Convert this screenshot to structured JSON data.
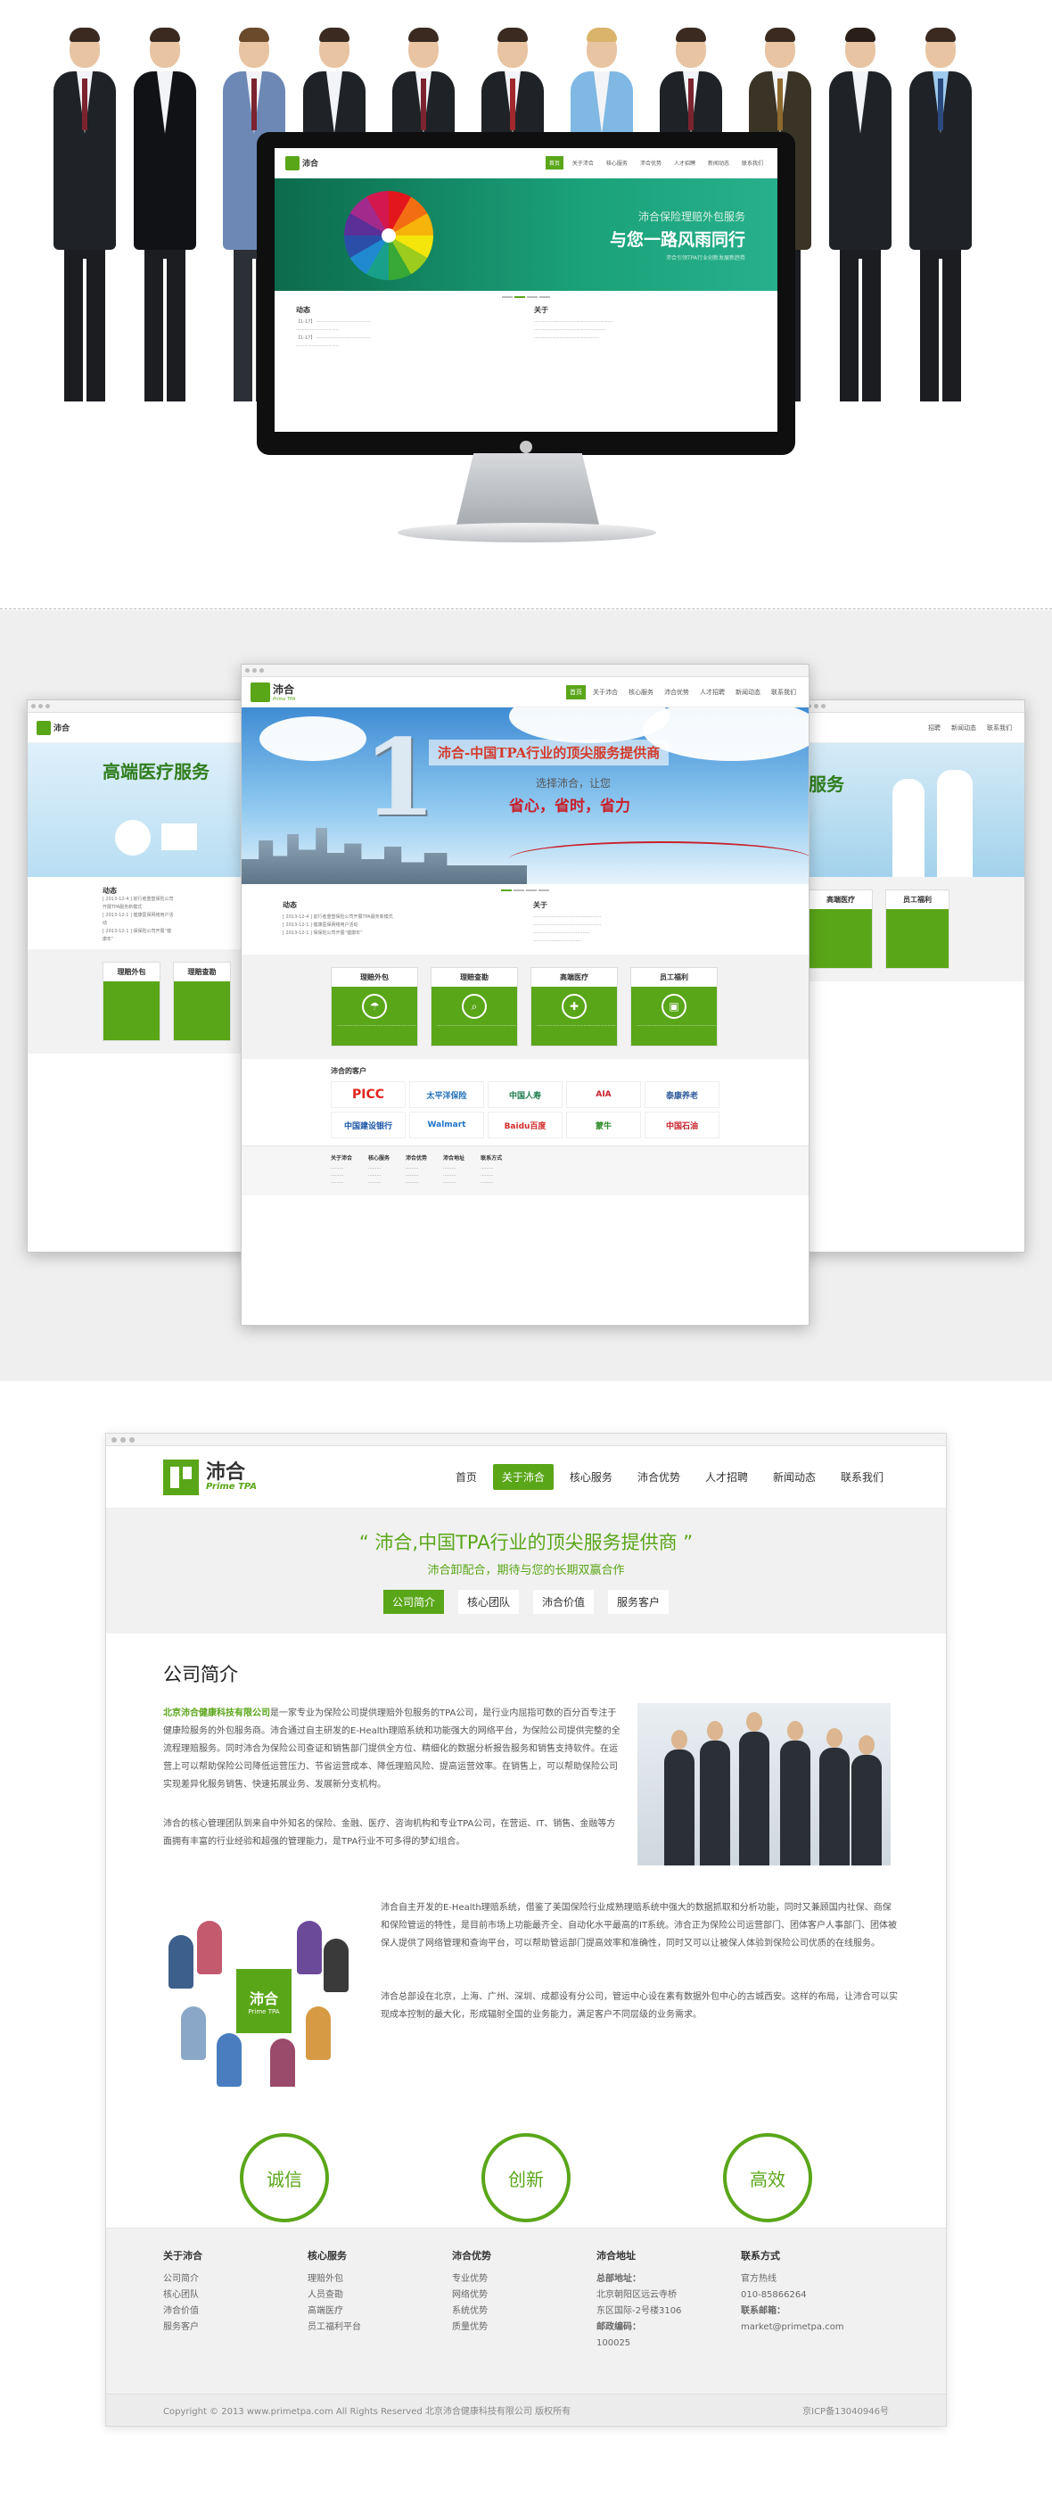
{
  "monitor": {
    "logo_text": "沛合",
    "nav": [
      "首页",
      "关于沛合",
      "核心服务",
      "沛合优势",
      "人才招聘",
      "新闻动态",
      "联系我们"
    ],
    "hero_line1": "沛合保险理赔外包服务",
    "hero_line2": "与您一路风雨同行",
    "hero_line3": "沛合引领TPA行业创新发展新趋势",
    "news_title": "动态",
    "about_title": "关于"
  },
  "showcase": {
    "logo_text": "沛合",
    "logo_en": "Prime TPA",
    "nav": [
      "首页",
      "关于沛合",
      "核心服务",
      "沛合优势",
      "人才招聘",
      "新闻动态",
      "联系我们"
    ],
    "hero_tagline": "沛合-中国TPA行业的顶尖服务提供商",
    "hero_sub1": "选择沛合，让您",
    "hero_sub2": "省心，省时，省力",
    "left_hero": "高端医疗服务",
    "right_hero": "服务",
    "news_title": "动态",
    "news_items": [
      "[ 2013-12-4 ] 前行者重塑保险公司开展TPA服务新模式",
      "[ 2013-12-1 ] 健康医保网络用户活动",
      "[ 2013-12-1 ] 保保险公司开展“健康年”"
    ],
    "about_title": "关于",
    "services": [
      {
        "name": "理赔外包",
        "icon": "umbrella-icon"
      },
      {
        "name": "理赔查勘",
        "icon": "magnifier-icon"
      },
      {
        "name": "高端医疗",
        "icon": "ambulance-icon"
      },
      {
        "name": "员工福利",
        "icon": "gift-icon"
      }
    ],
    "clients_title": "沛合的客户",
    "clients": [
      "PICC",
      "太平洋保险",
      "中国人寿",
      "AIA",
      "泰康养老",
      "中国建设银行",
      "Walmart",
      "Baidu百度",
      "蒙牛",
      "中国石油"
    ]
  },
  "about": {
    "logo_text": "沛合",
    "logo_en": "Prime TPA",
    "nav": [
      "首页",
      "关于沛合",
      "核心服务",
      "沛合优势",
      "人才招聘",
      "新闻动态",
      "联系我们"
    ],
    "nav_active": 1,
    "banner_quote": "“ 沛合,中国TPA行业的顶尖服务提供商 ”",
    "banner_sub": "沛合卸配合，期待与您的长期双赢合作",
    "tabs": [
      "公司简介",
      "核心团队",
      "沛合价值",
      "服务客户"
    ],
    "section_title": "公司简介",
    "company_name": "北京沛合健康科技有限公司",
    "para1": "是一家专业为保险公司提供理赔外包服务的TPA公司，是行业内屈指可数的百分百专注于健康险服务的外包服务商。沛合通过自主研发的E-Health理赔系统和功能强大的网络平台，为保险公司提供完整的全流程理赔服务。同时沛合为保险公司查证和销售部门提供全方位、精细化的数据分析报告服务和销售支持软件。在运营上可以帮助保险公司降低运营压力、节省运营成本、降低理赔风险、提高运营效率。在销售上，可以帮助保险公司实现差异化服务销售、快速拓展业务、发展新分支机构。",
    "para2": "沛合的核心管理团队到来自中外知名的保险、金融、医疗、咨询机构和专业TPA公司，在营运、IT、销售、金融等方面拥有丰富的行业经验和超强的管理能力，是TPA行业不可多得的梦幻组合。",
    "para3": "沛合自主开发的E-Health理赔系统，借鉴了美国保险行业成熟理赔系统中强大的数据抓取和分析功能，同时又兼顾国内社保、商保和保险管运的特性，是目前市场上功能最齐全、自动化水平最高的IT系统。沛合正为保险公司运营部门、团体客户人事部门、团体被保人提供了网络管理和查询平台，可以帮助管运部门提高效率和准确性，同时又可以让被保人体验到保险公司优质的在线服务。",
    "para4": "沛合总部设在北京，上海、广州、深圳、成都设有分公司，管运中心设在素有数据外包中心的古城西安。这样的布局，让沛合可以实现成本控制的最大化，形成辐射全国的业务能力，满足客户不同层级的业务需求。",
    "values": [
      "诚信",
      "创新",
      "高效"
    ],
    "footer": {
      "cols": [
        {
          "title": "关于沛合",
          "items": [
            "公司简介",
            "核心团队",
            "沛合价值",
            "服务客户"
          ]
        },
        {
          "title": "核心服务",
          "items": [
            "理赔外包",
            "人员查勘",
            "高端医疗",
            "员工福利平台"
          ]
        },
        {
          "title": "沛合优势",
          "items": [
            "专业优势",
            "网络优势",
            "系统优势",
            "质量优势"
          ]
        },
        {
          "title": "沛合地址",
          "items": [
            "总部地址：",
            "北京朝阳区远云寺桥",
            "东区国际-2号楼3106",
            "邮政编码：",
            "100025"
          ]
        },
        {
          "title": "联系方式",
          "items": [
            "官方热线",
            "010-85866264",
            "联系邮箱：",
            "market@primetpa.com"
          ]
        }
      ],
      "copyright": "Copyright © 2013 www.primetpa.com All Rights Reserved 北京沛合健康科技有限公司 版权所有",
      "icp": "京ICP备13040946号"
    }
  },
  "colors": {
    "accent": "#5aa619",
    "teal": "#1aa179",
    "sky": "#3f8cd4"
  }
}
